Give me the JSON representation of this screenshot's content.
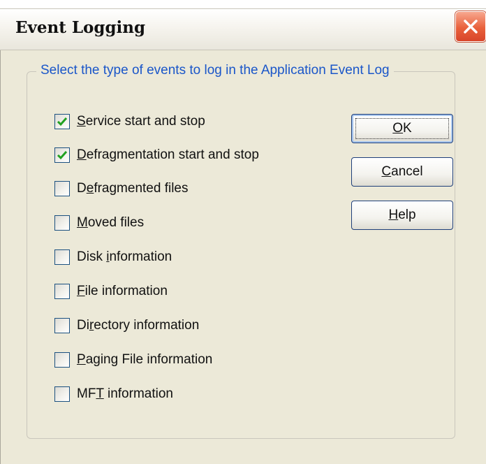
{
  "window": {
    "title": "Event Logging"
  },
  "group": {
    "legend": "Select the type of events to log in the Application Event Log"
  },
  "options": [
    {
      "pre": "",
      "mn": "S",
      "post": "ervice start and stop",
      "checked": true
    },
    {
      "pre": "",
      "mn": "D",
      "post": "efragmentation start and stop",
      "checked": true
    },
    {
      "pre": "D",
      "mn": "e",
      "post": "fragmented files",
      "checked": false
    },
    {
      "pre": "",
      "mn": "M",
      "post": "oved files",
      "checked": false
    },
    {
      "pre": "Disk ",
      "mn": "i",
      "post": "nformation",
      "checked": false
    },
    {
      "pre": "",
      "mn": "F",
      "post": "ile information",
      "checked": false
    },
    {
      "pre": "Di",
      "mn": "r",
      "post": "ectory information",
      "checked": false
    },
    {
      "pre": "",
      "mn": "P",
      "post": "aging File information",
      "checked": false
    },
    {
      "pre": "MF",
      "mn": "T",
      "post": " information",
      "checked": false
    }
  ],
  "buttons": {
    "ok": {
      "pre": "",
      "mn": "O",
      "post": "K"
    },
    "cancel": {
      "pre": "",
      "mn": "C",
      "post": "ancel"
    },
    "help": {
      "pre": "",
      "mn": "H",
      "post": "elp"
    }
  },
  "colors": {
    "accent_text": "#1a56c9",
    "check_mark": "#21a121",
    "close_button": "#e9613b"
  },
  "icons": {
    "close": "close-x-icon",
    "check": "checkmark-icon"
  }
}
